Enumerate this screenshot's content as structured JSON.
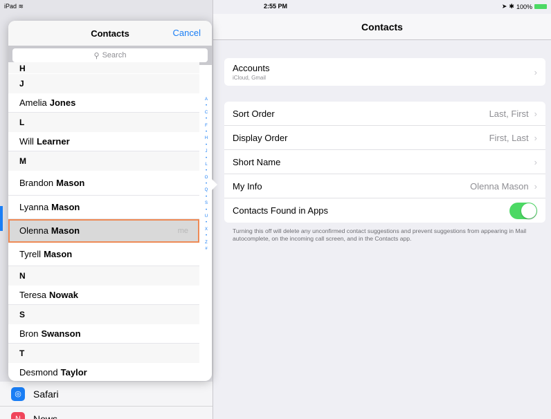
{
  "status_bar": {
    "device": "iPad",
    "time": "2:55 PM",
    "battery": "100%"
  },
  "detail": {
    "title": "Contacts",
    "accounts": {
      "label": "Accounts",
      "sub": "iCloud, Gmail"
    },
    "settings": [
      {
        "label": "Sort Order",
        "value": "Last, First"
      },
      {
        "label": "Display Order",
        "value": "First, Last"
      },
      {
        "label": "Short Name",
        "value": ""
      },
      {
        "label": "My Info",
        "value": "Olenna Mason"
      },
      {
        "label": "Contacts Found in Apps",
        "value": ""
      }
    ],
    "toggle_state": "on",
    "footnote": "Turning this off will delete any unconfirmed contact suggestions and prevent suggestions from appearing in Mail autocomplete, on the incoming call screen, and in the Contacts app."
  },
  "popover": {
    "title": "Contacts",
    "cancel": "Cancel",
    "search_placeholder": "Search",
    "partial_header": "H",
    "rows": [
      {
        "type": "header",
        "text": "J"
      },
      {
        "type": "name",
        "first": "Amelia",
        "last": "Jones"
      },
      {
        "type": "header",
        "text": "L"
      },
      {
        "type": "name",
        "first": "Will",
        "last": "Learner"
      },
      {
        "type": "header",
        "text": "M"
      },
      {
        "type": "name",
        "first": "Brandon",
        "last": "Mason"
      },
      {
        "type": "name",
        "first": "Lyanna",
        "last": "Mason"
      },
      {
        "type": "name",
        "first": "Olenna",
        "last": "Mason",
        "tag": "me",
        "selected": true
      },
      {
        "type": "name",
        "first": "Tyrell",
        "last": "Mason"
      },
      {
        "type": "header",
        "text": "N"
      },
      {
        "type": "name",
        "first": "Teresa",
        "last": "Nowak"
      },
      {
        "type": "header",
        "text": "S"
      },
      {
        "type": "name",
        "first": "Bron",
        "last": "Swanson"
      },
      {
        "type": "header",
        "text": "T"
      },
      {
        "type": "name",
        "first": "Desmond",
        "last": "Taylor"
      }
    ],
    "index": [
      "A",
      "•",
      "C",
      "•",
      "F",
      "•",
      "H",
      "•",
      "J",
      "•",
      "L",
      "•",
      "O",
      "•",
      "Q",
      "•",
      "S",
      "•",
      "U",
      "•",
      "X",
      "•",
      "Z",
      "#"
    ]
  },
  "background_list": [
    {
      "label": "Safari",
      "icon": "safari-icon",
      "color": "#1a7ef5"
    },
    {
      "label": "News",
      "icon": "news-icon",
      "color": "#f0445a"
    }
  ],
  "colors": {
    "accent": "#1a7ef5",
    "toggle": "#4cd964",
    "highlight": "#ee8a55"
  }
}
